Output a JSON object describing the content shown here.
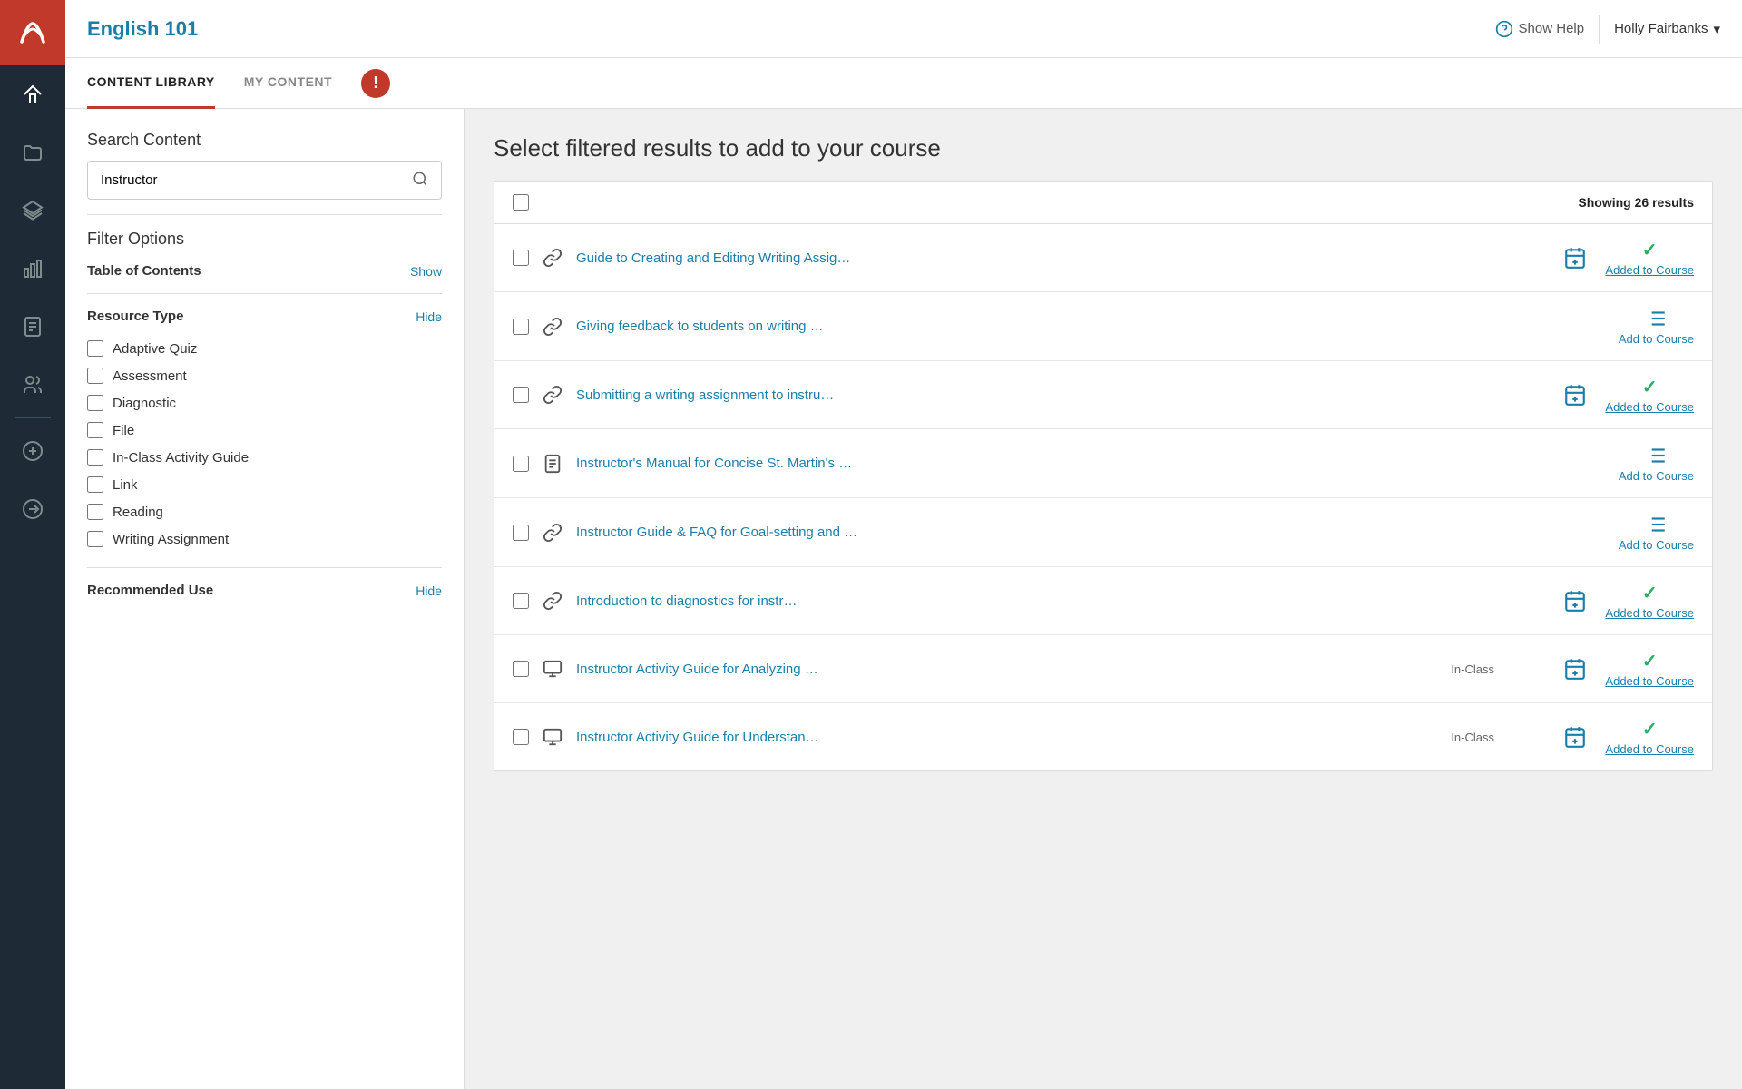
{
  "nav": {
    "logo_alt": "App logo",
    "items": [
      {
        "id": "home",
        "label": "Home",
        "icon": "home"
      },
      {
        "id": "folder",
        "label": "Folder",
        "icon": "folder"
      },
      {
        "id": "layers",
        "label": "Layers",
        "icon": "layers"
      },
      {
        "id": "chart",
        "label": "Chart",
        "icon": "chart"
      },
      {
        "id": "document",
        "label": "Document",
        "icon": "document"
      },
      {
        "id": "people",
        "label": "People",
        "icon": "people"
      }
    ],
    "add_icon": "plus",
    "switch_icon": "switch"
  },
  "header": {
    "course_title": "English 101",
    "show_help_label": "Show Help",
    "user_name": "Holly Fairbanks",
    "user_dropdown": "▾"
  },
  "tabs": {
    "items": [
      {
        "id": "content-library",
        "label": "CONTENT LIBRARY",
        "active": true
      },
      {
        "id": "my-content",
        "label": "MY CONTENT",
        "active": false
      }
    ],
    "alert_icon": "!"
  },
  "filter": {
    "search_label": "Search Content",
    "search_placeholder": "Instructor",
    "search_value": "Instructor",
    "filter_options_label": "Filter Options",
    "sections": [
      {
        "id": "table-of-contents",
        "title": "Table of Contents",
        "toggle": "Show"
      },
      {
        "id": "resource-type",
        "title": "Resource Type",
        "toggle": "Hide",
        "checkboxes": [
          {
            "id": "adaptive-quiz",
            "label": "Adaptive Quiz",
            "checked": false
          },
          {
            "id": "assessment",
            "label": "Assessment",
            "checked": false
          },
          {
            "id": "diagnostic",
            "label": "Diagnostic",
            "checked": false
          },
          {
            "id": "file",
            "label": "File",
            "checked": false
          },
          {
            "id": "in-class-activity-guide",
            "label": "In-Class Activity Guide",
            "checked": false
          },
          {
            "id": "link",
            "label": "Link",
            "checked": false
          },
          {
            "id": "reading",
            "label": "Reading",
            "checked": false
          },
          {
            "id": "writing-assignment",
            "label": "Writing Assignment",
            "checked": false
          }
        ]
      },
      {
        "id": "recommended-use",
        "title": "Recommended Use",
        "toggle": "Hide"
      }
    ]
  },
  "content": {
    "heading": "Select filtered results to add to your course",
    "showing_label": "Showing 26 results",
    "results": [
      {
        "id": 1,
        "title": "Guide to Creating and Editing Writing Assig…",
        "icon": "link",
        "badge": "",
        "status": "added",
        "added_label": "Added to Course"
      },
      {
        "id": 2,
        "title": "Giving feedback to students on writing …",
        "icon": "link",
        "badge": "",
        "status": "add",
        "add_label": "Add to Course"
      },
      {
        "id": 3,
        "title": "Submitting a writing assignment to instru…",
        "icon": "link",
        "badge": "",
        "status": "added",
        "added_label": "Added to Course"
      },
      {
        "id": 4,
        "title": "Instructor's Manual for Concise St. Martin's …",
        "icon": "document",
        "badge": "",
        "status": "add",
        "add_label": "Add to Course"
      },
      {
        "id": 5,
        "title": "Instructor Guide & FAQ for Goal-setting and …",
        "icon": "link",
        "badge": "",
        "status": "add",
        "add_label": "Add to Course"
      },
      {
        "id": 6,
        "title": "Introduction to diagnostics for instr…",
        "icon": "link",
        "badge": "",
        "status": "added",
        "added_label": "Added to Course"
      },
      {
        "id": 7,
        "title": "Instructor Activity Guide for Analyzing …",
        "icon": "monitor",
        "badge": "In-Class",
        "status": "added",
        "added_label": "Added to Course"
      },
      {
        "id": 8,
        "title": "Instructor Activity Guide for Understan…",
        "icon": "monitor",
        "badge": "In-Class",
        "status": "added",
        "added_label": "Added to Course"
      }
    ]
  }
}
